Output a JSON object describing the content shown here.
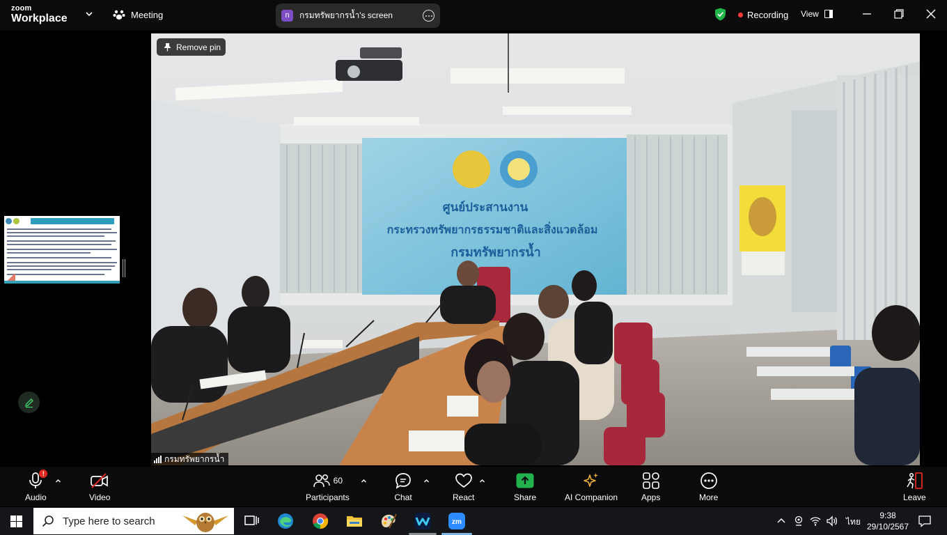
{
  "topbar": {
    "brand_line1": "zoom",
    "brand_line2": "Workplace",
    "meeting_label": "Meeting",
    "share_avatar": "n",
    "share_title": "กรมทรัพยากรน้ำ's screen",
    "recording_label": "Recording",
    "view_label": "View",
    "icons": [
      "chevron-down-icon",
      "paw-icon",
      "more-horizontal-icon",
      "shield-check-icon",
      "minimize-icon",
      "maximize-icon",
      "close-icon"
    ]
  },
  "stage": {
    "remove_pin_label": "Remove pin",
    "participant_name": "กรมทรัพยากรน้ำ",
    "banner_line1": "ศูนย์ประสานงาน",
    "banner_line2": "กระทรวงทรัพยากรธรรมชาติและสิ่งแวดล้อม",
    "banner_line3": "กรมทรัพยากรน้ำ"
  },
  "toolbar": {
    "audio_label": "Audio",
    "audio_badge": "!",
    "video_label": "Video",
    "participants_label": "Participants",
    "participants_count": "60",
    "chat_label": "Chat",
    "react_label": "React",
    "share_label": "Share",
    "ai_label": "AI Companion",
    "apps_label": "Apps",
    "more_label": "More",
    "leave_label": "Leave",
    "colors": {
      "share_green": "#22b14c",
      "badge_red": "#e0291f",
      "recording_red": "#ff3b3b",
      "shield_green": "#1fb548"
    }
  },
  "taskbar": {
    "search_placeholder": "Type here to search",
    "language": "ไทย",
    "time": "9:38",
    "date": "29/10/2567",
    "apps": [
      "task-view-icon",
      "edge-icon",
      "chrome-icon",
      "file-explorer-icon",
      "paint-icon",
      "webex-icon",
      "zoom-icon"
    ]
  }
}
